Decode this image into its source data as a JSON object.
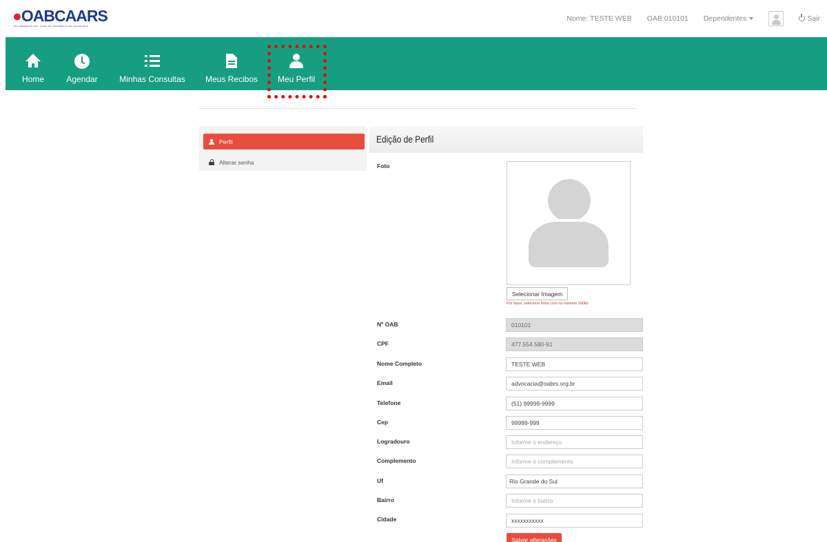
{
  "brand": {
    "wordmark_oab": "OAB",
    "wordmark_caars": "CAARS",
    "tagline": "RIO GRANDE DO SUL · CAIXA DE ASSISTÊNCIA DOS ADVOGADOS"
  },
  "topbar": {
    "user_name": "Nome: TESTE WEB",
    "oab_number": "OAB:010101",
    "dependents_label": "Dependentes",
    "logout_label": "Sair",
    "icons": [
      "avatar-icon",
      "power-icon",
      "caret-down-icon"
    ]
  },
  "nav": {
    "accent_color": "#179e80",
    "items": [
      {
        "label": "Home",
        "icon": "home-icon"
      },
      {
        "label": "Agendar",
        "icon": "clock-icon"
      },
      {
        "label": "Minhas Consultas",
        "icon": "list-icon"
      },
      {
        "label": "Meus Recibos",
        "icon": "document-icon"
      },
      {
        "label": "Meu Perfil",
        "icon": "user-icon",
        "active": true
      }
    ]
  },
  "sidebar": {
    "items": [
      {
        "label": "Perfil",
        "icon": "user-icon",
        "active": true
      },
      {
        "label": "Alterar senha",
        "icon": "lock-icon"
      }
    ]
  },
  "profile": {
    "title": "Edição de Perfil",
    "photo_label": "Foto",
    "select_image_label": "Selecionar Imagem",
    "photo_hint": "Por favor, selecione fotos com no máximo 300kb",
    "fields": {
      "oab": {
        "label": "Nº OAB",
        "value": "010101"
      },
      "cpf": {
        "label": "CPF",
        "value": "477.554.580-91"
      },
      "nome": {
        "label": "Nome Completo",
        "value": "TESTE WEB"
      },
      "email": {
        "label": "Email",
        "value": "advocacia@oabrs.org.br"
      },
      "telefone": {
        "label": "Telefone",
        "value": "(51) 99999-9999"
      },
      "cep": {
        "label": "Cep",
        "value": "99999-999"
      },
      "logradouro": {
        "label": "Logradouro",
        "value": "",
        "placeholder": "Informe o endereço"
      },
      "complemento": {
        "label": "Complemento",
        "value": "",
        "placeholder": "Informe o complemento"
      },
      "uf": {
        "label": "Uf",
        "value": "Rio Grande do Sul"
      },
      "bairro": {
        "label": "Bairro",
        "value": "",
        "placeholder": "Informe o bairro"
      },
      "cidade": {
        "label": "Cidade",
        "value": "xxxxxxxxxxx"
      }
    },
    "save_label": "Salvar alterações",
    "save_color": "#e84c3d"
  }
}
